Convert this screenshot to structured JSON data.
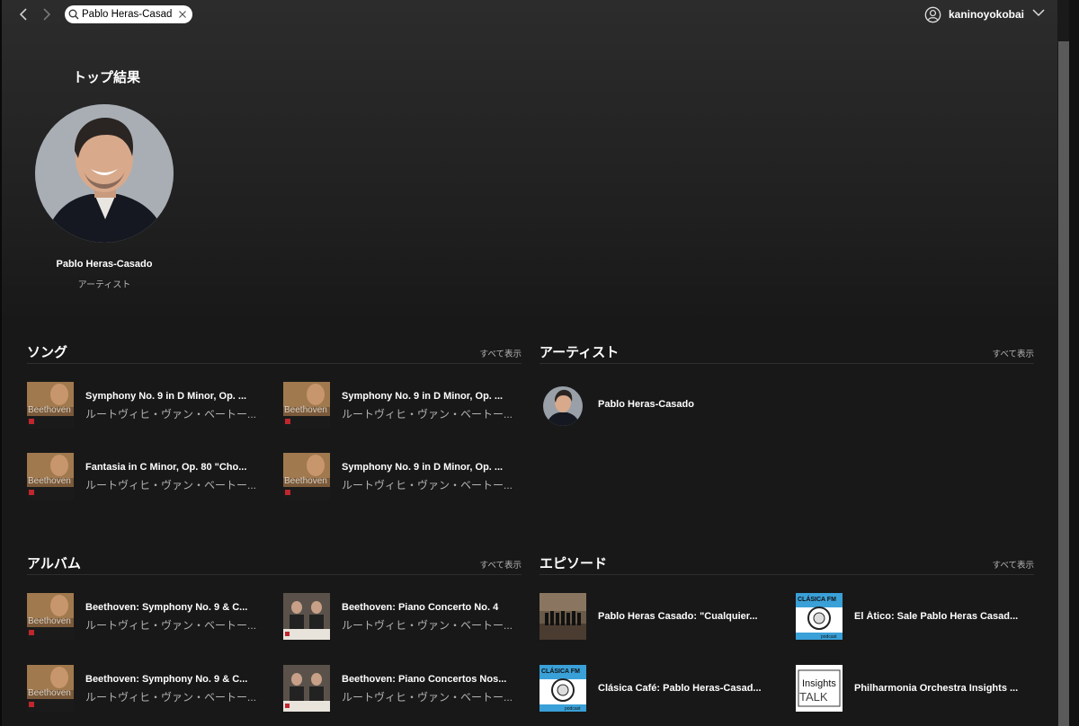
{
  "topbar": {
    "search_value": "Pablo Heras-Casado",
    "user_name": "kaninoyokobai"
  },
  "top_result": {
    "heading": "トップ結果",
    "name": "Pablo Heras-Casado",
    "type": "アーティスト"
  },
  "songs": {
    "heading": "ソング",
    "see_all": "すべて表示",
    "items": [
      {
        "title": "Symphony No. 9 in D Minor, Op. ...",
        "subtitle": "ルートヴィヒ・ヴァン・ベートー..."
      },
      {
        "title": "Symphony No. 9 in D Minor, Op. ...",
        "subtitle": "ルートヴィヒ・ヴァン・ベートー..."
      },
      {
        "title": "Fantasia in C Minor, Op. 80 \"Cho...",
        "subtitle": "ルートヴィヒ・ヴァン・ベートー..."
      },
      {
        "title": "Symphony No. 9 in D Minor, Op. ...",
        "subtitle": "ルートヴィヒ・ヴァン・ベートー..."
      }
    ]
  },
  "artists": {
    "heading": "アーティスト",
    "see_all": "すべて表示",
    "items": [
      {
        "name": "Pablo Heras-Casado"
      }
    ]
  },
  "albums": {
    "heading": "アルバム",
    "see_all": "すべて表示",
    "items": [
      {
        "title": "Beethoven: Symphony No. 9 & C...",
        "subtitle": "ルートヴィヒ・ヴァン・ベートー..."
      },
      {
        "title": "Beethoven: Piano Concerto No. 4",
        "subtitle": "ルートヴィヒ・ヴァン・ベートー..."
      },
      {
        "title": "Beethoven: Symphony No. 9 & C...",
        "subtitle": "ルートヴィヒ・ヴァン・ベートー..."
      },
      {
        "title": "Beethoven: Piano Concertos Nos...",
        "subtitle": "ルートヴィヒ・ヴァン・ベートー..."
      }
    ]
  },
  "episodes": {
    "heading": "エピソード",
    "see_all": "すべて表示",
    "items": [
      {
        "title": "Pablo Heras Casado: \"Cualquier..."
      },
      {
        "title": "El Ático: Sale Pablo Heras Casad..."
      },
      {
        "title": "Clásica Café: Pablo Heras-Casad..."
      },
      {
        "title": "Philharmonia Orchestra Insights ..."
      }
    ]
  },
  "cover_text": {
    "beethoven": "Beethoven",
    "clasica": "CLÁSICA FM",
    "podcast": "podcast",
    "insights": "Insights",
    "talk": "TALK"
  }
}
